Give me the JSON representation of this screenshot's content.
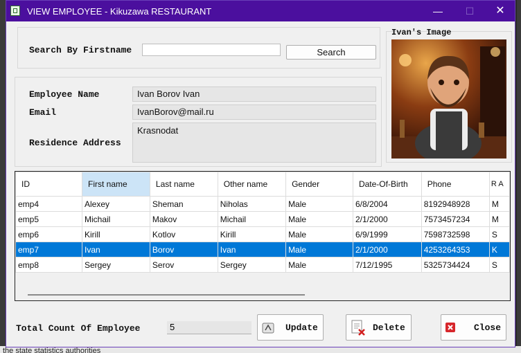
{
  "background": {
    "bottom_text": "the state statistics authorities"
  },
  "window": {
    "title": "VIEW EMPLOYEE - Kikuzawa RESTAURANT",
    "titlebar_color": "#4b0f9e",
    "controls": {
      "minimize": "—",
      "maximize": "☐",
      "close": "✕"
    }
  },
  "search": {
    "label": "Search By Firstname",
    "value": "",
    "button": "Search"
  },
  "details": {
    "name_label": "Employee Name",
    "name_value": "Ivan Borov Ivan",
    "email_label": "Email",
    "email_value": "IvanBorov@mail.ru",
    "address_label": "Residence Address",
    "address_value": "Krasnodat"
  },
  "image": {
    "title": "Ivan's Image"
  },
  "table": {
    "columns": [
      "ID",
      "First name",
      "Last name",
      "Other name",
      "Gender",
      "Date-Of-Birth",
      "Phone",
      "R A"
    ],
    "rows": [
      [
        "emp4",
        "Alexey",
        "Sheman",
        "Niholas",
        "Male",
        "6/8/2004",
        "8192948928",
        "M"
      ],
      [
        "emp5",
        "Michail",
        "Makov",
        "Michail",
        "Male",
        "2/1/2000",
        "7573457234",
        "M"
      ],
      [
        "emp6",
        "Kirill",
        "Kotlov",
        "Kirill",
        "Male",
        "6/9/1999",
        "7598732598",
        "S"
      ],
      [
        "emp7",
        "Ivan",
        "Borov",
        "Ivan",
        "Male",
        "2/1/2000",
        "4253264353",
        "K"
      ],
      [
        "emp8",
        "Sergey",
        "Serov",
        "Sergey",
        "Male",
        "7/12/1995",
        "5325734424",
        "S"
      ]
    ],
    "selected_row_color": "#0078d7"
  },
  "footer": {
    "count_label": "Total Count Of Employee",
    "count_value": "5",
    "update": "Update",
    "delete": "Delete",
    "close": "Close"
  }
}
